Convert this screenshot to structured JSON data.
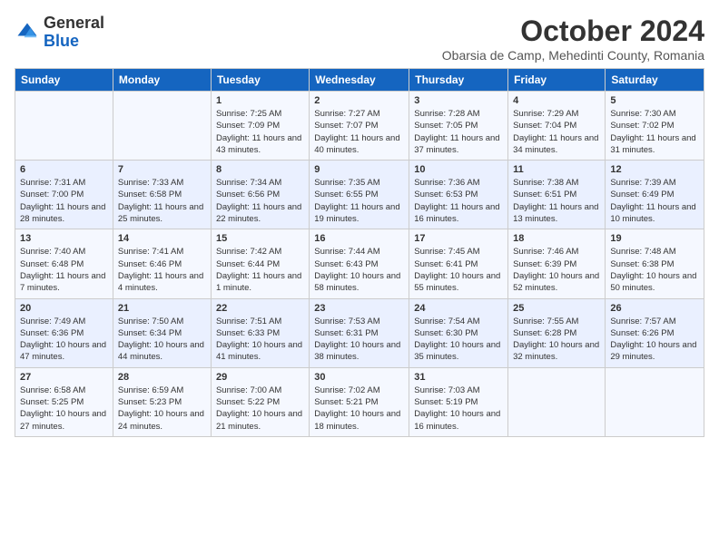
{
  "header": {
    "logo_general": "General",
    "logo_blue": "Blue",
    "month_title": "October 2024",
    "subtitle": "Obarsia de Camp, Mehedinti County, Romania"
  },
  "weekdays": [
    "Sunday",
    "Monday",
    "Tuesday",
    "Wednesday",
    "Thursday",
    "Friday",
    "Saturday"
  ],
  "weeks": [
    [
      {
        "day": "",
        "info": ""
      },
      {
        "day": "",
        "info": ""
      },
      {
        "day": "1",
        "info": "Sunrise: 7:25 AM\nSunset: 7:09 PM\nDaylight: 11 hours and 43 minutes."
      },
      {
        "day": "2",
        "info": "Sunrise: 7:27 AM\nSunset: 7:07 PM\nDaylight: 11 hours and 40 minutes."
      },
      {
        "day": "3",
        "info": "Sunrise: 7:28 AM\nSunset: 7:05 PM\nDaylight: 11 hours and 37 minutes."
      },
      {
        "day": "4",
        "info": "Sunrise: 7:29 AM\nSunset: 7:04 PM\nDaylight: 11 hours and 34 minutes."
      },
      {
        "day": "5",
        "info": "Sunrise: 7:30 AM\nSunset: 7:02 PM\nDaylight: 11 hours and 31 minutes."
      }
    ],
    [
      {
        "day": "6",
        "info": "Sunrise: 7:31 AM\nSunset: 7:00 PM\nDaylight: 11 hours and 28 minutes."
      },
      {
        "day": "7",
        "info": "Sunrise: 7:33 AM\nSunset: 6:58 PM\nDaylight: 11 hours and 25 minutes."
      },
      {
        "day": "8",
        "info": "Sunrise: 7:34 AM\nSunset: 6:56 PM\nDaylight: 11 hours and 22 minutes."
      },
      {
        "day": "9",
        "info": "Sunrise: 7:35 AM\nSunset: 6:55 PM\nDaylight: 11 hours and 19 minutes."
      },
      {
        "day": "10",
        "info": "Sunrise: 7:36 AM\nSunset: 6:53 PM\nDaylight: 11 hours and 16 minutes."
      },
      {
        "day": "11",
        "info": "Sunrise: 7:38 AM\nSunset: 6:51 PM\nDaylight: 11 hours and 13 minutes."
      },
      {
        "day": "12",
        "info": "Sunrise: 7:39 AM\nSunset: 6:49 PM\nDaylight: 11 hours and 10 minutes."
      }
    ],
    [
      {
        "day": "13",
        "info": "Sunrise: 7:40 AM\nSunset: 6:48 PM\nDaylight: 11 hours and 7 minutes."
      },
      {
        "day": "14",
        "info": "Sunrise: 7:41 AM\nSunset: 6:46 PM\nDaylight: 11 hours and 4 minutes."
      },
      {
        "day": "15",
        "info": "Sunrise: 7:42 AM\nSunset: 6:44 PM\nDaylight: 11 hours and 1 minute."
      },
      {
        "day": "16",
        "info": "Sunrise: 7:44 AM\nSunset: 6:43 PM\nDaylight: 10 hours and 58 minutes."
      },
      {
        "day": "17",
        "info": "Sunrise: 7:45 AM\nSunset: 6:41 PM\nDaylight: 10 hours and 55 minutes."
      },
      {
        "day": "18",
        "info": "Sunrise: 7:46 AM\nSunset: 6:39 PM\nDaylight: 10 hours and 52 minutes."
      },
      {
        "day": "19",
        "info": "Sunrise: 7:48 AM\nSunset: 6:38 PM\nDaylight: 10 hours and 50 minutes."
      }
    ],
    [
      {
        "day": "20",
        "info": "Sunrise: 7:49 AM\nSunset: 6:36 PM\nDaylight: 10 hours and 47 minutes."
      },
      {
        "day": "21",
        "info": "Sunrise: 7:50 AM\nSunset: 6:34 PM\nDaylight: 10 hours and 44 minutes."
      },
      {
        "day": "22",
        "info": "Sunrise: 7:51 AM\nSunset: 6:33 PM\nDaylight: 10 hours and 41 minutes."
      },
      {
        "day": "23",
        "info": "Sunrise: 7:53 AM\nSunset: 6:31 PM\nDaylight: 10 hours and 38 minutes."
      },
      {
        "day": "24",
        "info": "Sunrise: 7:54 AM\nSunset: 6:30 PM\nDaylight: 10 hours and 35 minutes."
      },
      {
        "day": "25",
        "info": "Sunrise: 7:55 AM\nSunset: 6:28 PM\nDaylight: 10 hours and 32 minutes."
      },
      {
        "day": "26",
        "info": "Sunrise: 7:57 AM\nSunset: 6:26 PM\nDaylight: 10 hours and 29 minutes."
      }
    ],
    [
      {
        "day": "27",
        "info": "Sunrise: 6:58 AM\nSunset: 5:25 PM\nDaylight: 10 hours and 27 minutes."
      },
      {
        "day": "28",
        "info": "Sunrise: 6:59 AM\nSunset: 5:23 PM\nDaylight: 10 hours and 24 minutes."
      },
      {
        "day": "29",
        "info": "Sunrise: 7:00 AM\nSunset: 5:22 PM\nDaylight: 10 hours and 21 minutes."
      },
      {
        "day": "30",
        "info": "Sunrise: 7:02 AM\nSunset: 5:21 PM\nDaylight: 10 hours and 18 minutes."
      },
      {
        "day": "31",
        "info": "Sunrise: 7:03 AM\nSunset: 5:19 PM\nDaylight: 10 hours and 16 minutes."
      },
      {
        "day": "",
        "info": ""
      },
      {
        "day": "",
        "info": ""
      }
    ]
  ]
}
